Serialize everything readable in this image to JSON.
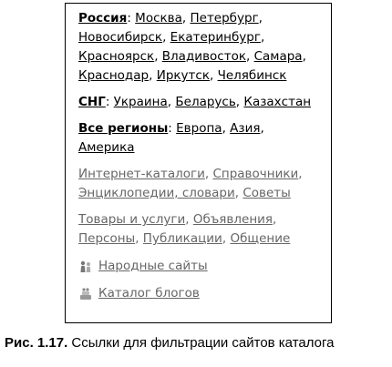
{
  "russia": {
    "heading": "Россия",
    "colon": ":",
    "cities": [
      "Москва",
      "Петербург",
      "Новосибирск",
      "Екатеринбург",
      "Красноярск",
      "Владивосток",
      "Самара",
      "Краснодар",
      "Иркутск",
      "Челябинск"
    ]
  },
  "cis": {
    "heading": "СНГ",
    "colon": ":",
    "items": [
      "Украина",
      "Беларусь",
      "Казахстан"
    ]
  },
  "regions": {
    "heading": "Все регионы",
    "colon": ":",
    "items": [
      "Европа",
      "Азия",
      "Америка"
    ]
  },
  "categories1": [
    "Интернет-каталоги",
    "Справочники",
    "Энциклопедии, словари",
    "Советы"
  ],
  "categories2": [
    "Товары и услуги",
    "Объявления",
    "Персоны",
    "Публикации",
    "Общение"
  ],
  "people_sites": {
    "label": "Народные сайты",
    "icon": "people-icon"
  },
  "blog_catalog": {
    "label": "Каталог блогов",
    "icon": "blog-icon"
  },
  "caption": {
    "prefix": "Рис. 1.17.",
    "text": " Ссылки для фильтрации сайтов каталога"
  }
}
